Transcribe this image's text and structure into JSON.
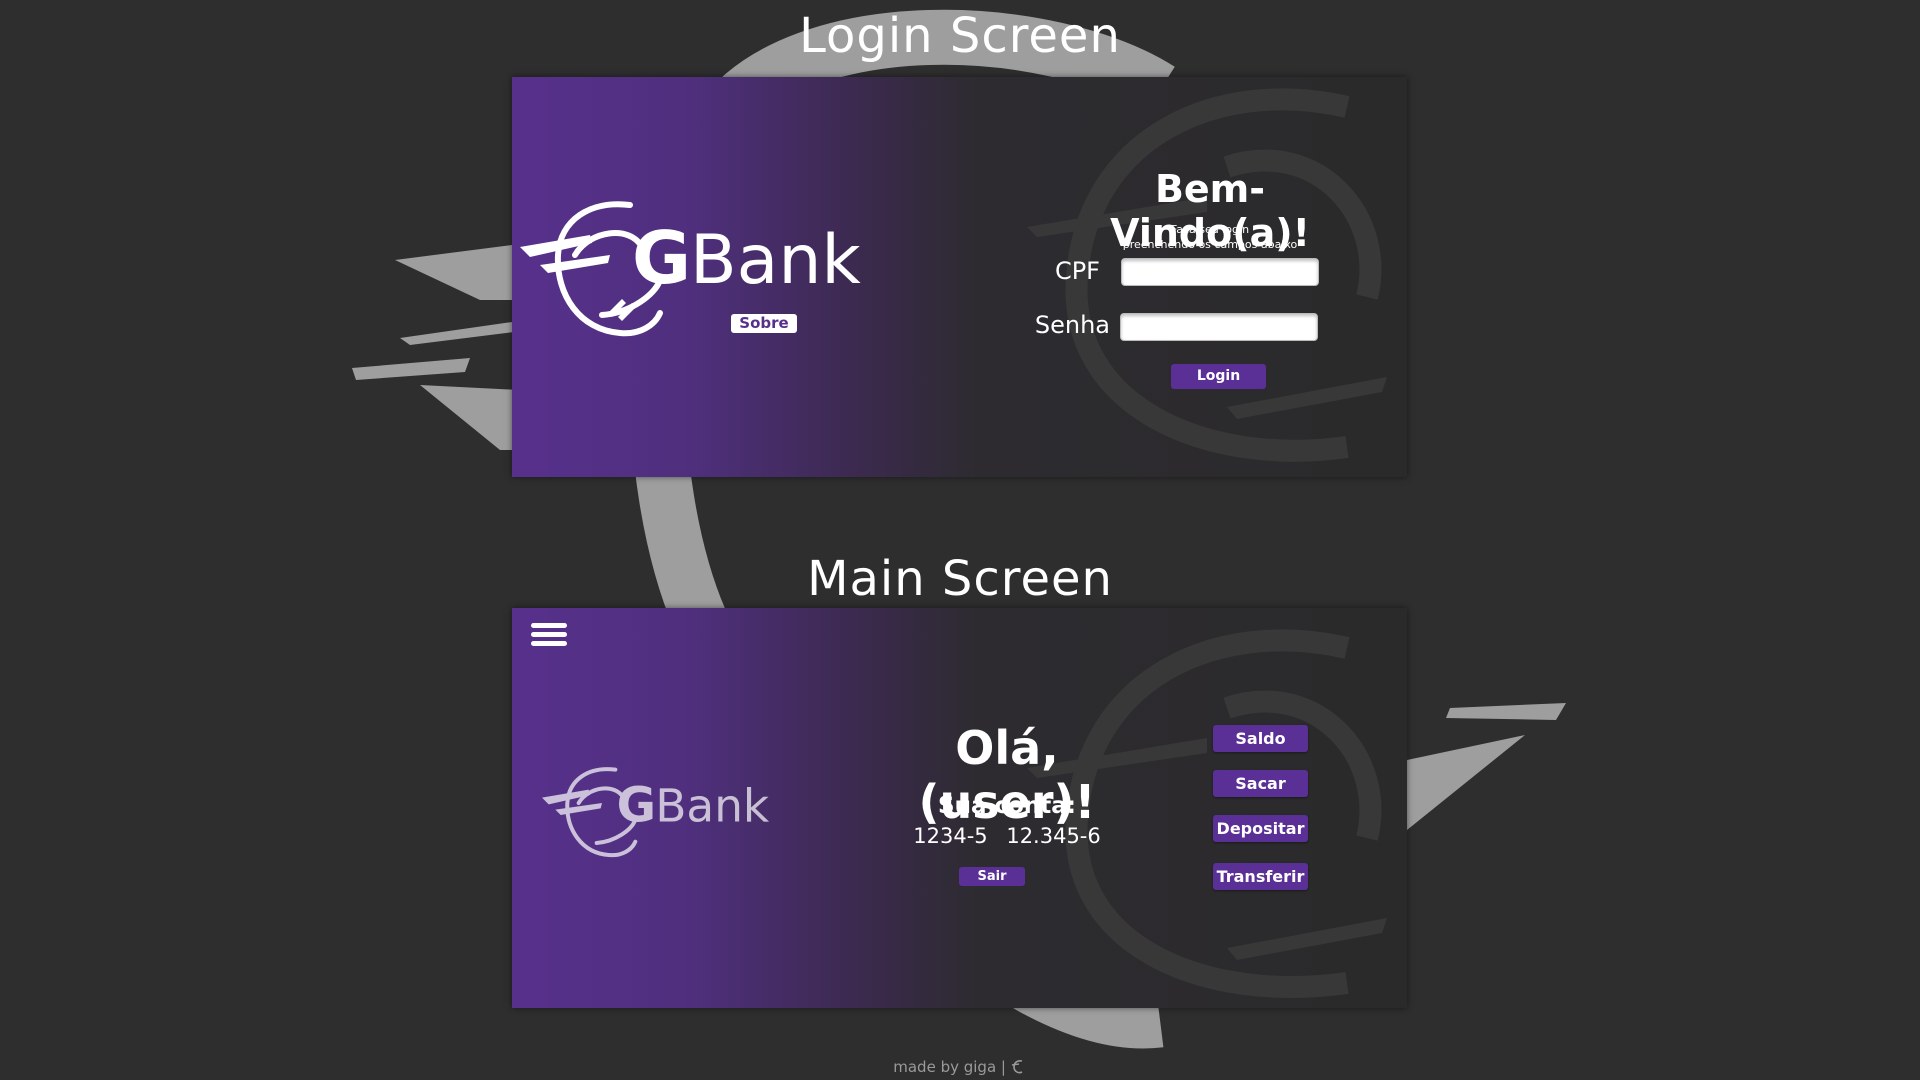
{
  "login_screen": {
    "section_title": "Login Screen",
    "brand": "GBank",
    "about_button": "Sobre",
    "welcome_title": "Bem-Vindo(a)!",
    "hint_line1": "Faça seu login",
    "hint_line2": "preenchendo os campos abaixo",
    "cpf_label": "CPF",
    "cpf_value": "",
    "password_label": "Senha",
    "password_value": "",
    "login_button": "Login"
  },
  "main_screen": {
    "section_title": "Main Screen",
    "brand": "GBank",
    "greeting": "Olá, (user)!",
    "account_label": "Sua conta:",
    "agency": "1234-5",
    "account_number": "12.345-6",
    "logout_button": "Sair",
    "actions": [
      "Saldo",
      "Sacar",
      "Depositar",
      "Transferir"
    ]
  },
  "footer": {
    "text": "made by giga |"
  },
  "colors": {
    "background": "#2e2e2e",
    "brand_purple": "#57308c",
    "button_purple": "#5a2f96",
    "decoration_gray": "#9e9e9e"
  },
  "icons": [
    "gbank-logo-icon",
    "hamburger-menu-icon",
    "gbank-mini-icon"
  ]
}
